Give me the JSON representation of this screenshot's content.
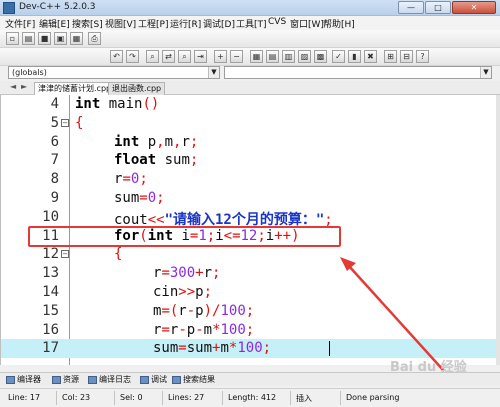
{
  "window": {
    "title": "Dev-C++ 5.2.0.3",
    "min": "—",
    "max": "□",
    "close": "✕"
  },
  "menu": [
    "文件[F]",
    "编辑[E]",
    "搜索[S]",
    "视图[V]",
    "工程[P]",
    "运行[R]",
    "调试[D]",
    "工具[T]",
    "CVS",
    "窗口[W]",
    "帮助[H]"
  ],
  "scope_combo": "(globals)",
  "tabs": [
    "津津的储蓄计划.cpp",
    "退出函数.cpp"
  ],
  "nav": {
    "left": "◄",
    "right": "►"
  },
  "code_lines": [
    {
      "n": "4",
      "fold": "",
      "indent": 0,
      "parts": [
        [
          "k",
          "int"
        ],
        [
          "t",
          " main"
        ],
        [
          "o",
          "()"
        ]
      ]
    },
    {
      "n": "5",
      "fold": "⊟",
      "indent": 0,
      "parts": [
        [
          "o",
          "{"
        ]
      ]
    },
    {
      "n": "6",
      "fold": "",
      "indent": 1,
      "parts": [
        [
          "k",
          "int"
        ],
        [
          "t",
          " p"
        ],
        [
          "o",
          ","
        ],
        [
          "t",
          "m"
        ],
        [
          "o",
          ","
        ],
        [
          "t",
          "r"
        ],
        [
          "o",
          ";"
        ]
      ]
    },
    {
      "n": "7",
      "fold": "",
      "indent": 1,
      "parts": [
        [
          "k",
          "float"
        ],
        [
          "t",
          " sum"
        ],
        [
          "o",
          ";"
        ]
      ]
    },
    {
      "n": "8",
      "fold": "",
      "indent": 1,
      "parts": [
        [
          "t",
          "r"
        ],
        [
          "o",
          "="
        ],
        [
          "n",
          "0"
        ],
        [
          "o",
          ";"
        ]
      ]
    },
    {
      "n": "9",
      "fold": "",
      "indent": 1,
      "parts": [
        [
          "t",
          "sum"
        ],
        [
          "o",
          "="
        ],
        [
          "n",
          "0"
        ],
        [
          "o",
          ";"
        ]
      ]
    },
    {
      "n": "10",
      "fold": "",
      "indent": 1,
      "parts": [
        [
          "t",
          "cout"
        ],
        [
          "o",
          "<<"
        ],
        [
          "s",
          "\"请输入12个月的预算：\""
        ],
        [
          "o",
          ";"
        ]
      ]
    },
    {
      "n": "11",
      "fold": "",
      "indent": 1,
      "parts": [
        [
          "k",
          "for"
        ],
        [
          "o",
          "("
        ],
        [
          "k",
          "int"
        ],
        [
          "t",
          " i"
        ],
        [
          "o",
          "="
        ],
        [
          "n",
          "1"
        ],
        [
          "o",
          ";"
        ],
        [
          "t",
          "i"
        ],
        [
          "o",
          "<="
        ],
        [
          "n",
          "12"
        ],
        [
          "o",
          ";"
        ],
        [
          "t",
          "i"
        ],
        [
          "o",
          "++)"
        ]
      ]
    },
    {
      "n": "12",
      "fold": "⊟",
      "indent": 1,
      "parts": [
        [
          "o",
          "{"
        ]
      ]
    },
    {
      "n": "13",
      "fold": "",
      "indent": 2,
      "parts": [
        [
          "t",
          "r"
        ],
        [
          "o",
          "="
        ],
        [
          "n",
          "300"
        ],
        [
          "o",
          "+"
        ],
        [
          "t",
          "r"
        ],
        [
          "o",
          ";"
        ]
      ]
    },
    {
      "n": "14",
      "fold": "",
      "indent": 2,
      "parts": [
        [
          "t",
          "cin"
        ],
        [
          "o",
          ">>"
        ],
        [
          "t",
          "p"
        ],
        [
          "o",
          ";"
        ]
      ]
    },
    {
      "n": "15",
      "fold": "",
      "indent": 2,
      "parts": [
        [
          "t",
          "m"
        ],
        [
          "o",
          "=("
        ],
        [
          "t",
          "r"
        ],
        [
          "o",
          "-"
        ],
        [
          "t",
          "p"
        ],
        [
          "o",
          ")/"
        ],
        [
          "n",
          "100"
        ],
        [
          "o",
          ";"
        ]
      ]
    },
    {
      "n": "16",
      "fold": "",
      "indent": 2,
      "parts": [
        [
          "t",
          "r"
        ],
        [
          "o",
          "="
        ],
        [
          "t",
          "r"
        ],
        [
          "o",
          "-"
        ],
        [
          "t",
          "p"
        ],
        [
          "o",
          "-"
        ],
        [
          "t",
          "m"
        ],
        [
          "o",
          "*"
        ],
        [
          "n",
          "100"
        ],
        [
          "o",
          ";"
        ]
      ]
    },
    {
      "n": "17",
      "fold": "",
      "indent": 2,
      "parts": [
        [
          "t",
          "sum"
        ],
        [
          "o",
          "="
        ],
        [
          "t",
          "sum"
        ],
        [
          "o",
          "+"
        ],
        [
          "t",
          "m"
        ],
        [
          "o",
          "*"
        ],
        [
          "n",
          "100"
        ],
        [
          "o",
          ";"
        ]
      ]
    }
  ],
  "current_line": "17",
  "bottom_tabs": [
    "编译器",
    "资源",
    "编译日志",
    "调试",
    "搜索结果"
  ],
  "status": {
    "line": "Line: 17",
    "col": "Col: 23",
    "sel": "Sel: 0",
    "lines": "Lines: 27",
    "length": "Length: 412",
    "mode": "插入",
    "msg": "Done parsing"
  },
  "watermark": "Bai du 经验",
  "colors": {
    "keyword": "#000000",
    "operator": "#e01010",
    "number": "#8a2be2",
    "string": "#1a35c9",
    "current_line": "#c6f0f8",
    "annotation": "#e53935"
  }
}
